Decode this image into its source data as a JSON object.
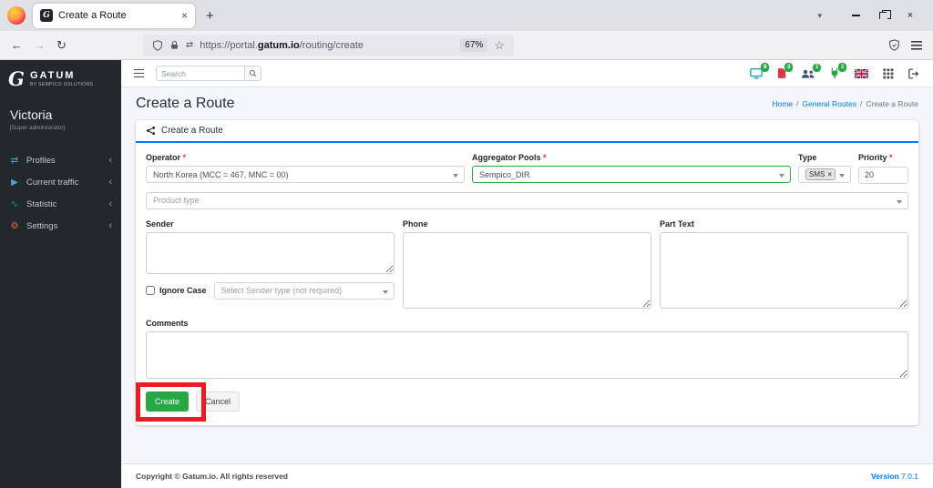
{
  "browser": {
    "tab_title": "Create a Route",
    "url": {
      "scheme": "https://portal.",
      "domain": "gatum.io",
      "path": "/routing/create"
    },
    "zoom": "67%"
  },
  "icons": {
    "new_tab": "+",
    "tab_close": "×",
    "window_close": "×",
    "tabs_chevron": "▾",
    "back": "←",
    "forward": "→",
    "reload": "↻",
    "permissions": "⇄",
    "star": "☆",
    "chevron_left": "‹",
    "profiles": "⇄",
    "traffic": "▶",
    "statistic": "∿",
    "settings": "⚙",
    "tag_remove": "×"
  },
  "sidebar": {
    "brand": "GATUM",
    "brand_sub": "BY SEMPICO SOLUTIONS",
    "user": "Victoria",
    "role": "[Super administrator]",
    "items": [
      {
        "label": "Profiles"
      },
      {
        "label": "Current traffic"
      },
      {
        "label": "Statistic"
      },
      {
        "label": "Settings"
      }
    ]
  },
  "topnav": {
    "search_placeholder": "Search",
    "badges": [
      "8",
      "3",
      "1",
      "2"
    ]
  },
  "page": {
    "title": "Create a Route",
    "breadcrumb_sep": "/",
    "breadcrumb": [
      {
        "label": "Home"
      },
      {
        "label": "General Routes"
      },
      {
        "label": "Create a Route"
      }
    ]
  },
  "card": {
    "title": "Create a Route"
  },
  "form": {
    "required_mark": "*",
    "operator": {
      "label": "Operator",
      "value": "North Korea (MCC = 467, MNC = 00)"
    },
    "aggregator": {
      "label": "Aggregator Pools",
      "value": "Sempico_DIR"
    },
    "type": {
      "label": "Type",
      "tag": "SMS"
    },
    "priority": {
      "label": "Priority",
      "value": "20"
    },
    "product_type": {
      "placeholder": "Product type"
    },
    "sender": {
      "label": "Sender"
    },
    "phone": {
      "label": "Phone"
    },
    "part_text": {
      "label": "Part Text"
    },
    "ignore_case": {
      "label": "Ignore Case"
    },
    "sender_type": {
      "placeholder": "Select Sender type (not required)"
    },
    "comments": {
      "label": "Comments"
    },
    "create_button": "Create",
    "cancel_button": "Cancel"
  },
  "footer": {
    "copyright": "Copyright © Gatum.io. All rights reserved",
    "version_label": "Version",
    "version": "7.0.1"
  },
  "colors": {
    "accent_blue": "#007bff",
    "success_green": "#28a745",
    "badge_green": "#28a745",
    "annotation_red": "#ec1c24",
    "sidebar_dark": "#23282d"
  }
}
